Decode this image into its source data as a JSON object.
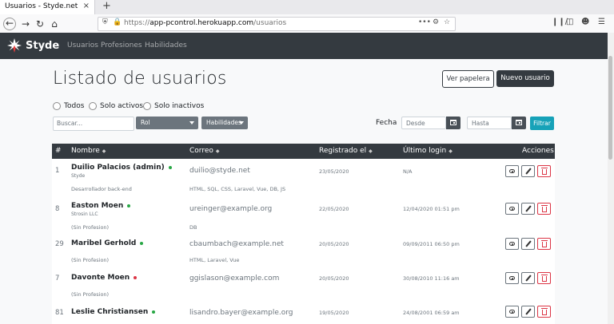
{
  "browser": {
    "tab_title": "Usuarios - Styde.net",
    "tab_close": "×",
    "new_tab": "+",
    "url_prefix": "https://",
    "url_host": "app-pcontrol.herokuapp.com",
    "url_path": "/usuarios",
    "url_more": "•••"
  },
  "app": {
    "brand": "Styde",
    "nav": [
      "Usuarios",
      "Profesiones",
      "Habilidades"
    ]
  },
  "page": {
    "title": "Listado de usuarios",
    "btn_trash": "Ver papelera",
    "btn_new": "Nuevo usuario"
  },
  "filters": {
    "radios": [
      "Todos",
      "Solo activos",
      "Solo inactivos"
    ],
    "search_placeholder": "Buscar...",
    "role_label": "Rol",
    "skills_label": "Habilidades",
    "date_label": "Fecha",
    "from_placeholder": "Desde",
    "to_placeholder": "Hasta",
    "filter_button": "Filtrar"
  },
  "table": {
    "headers": {
      "id": "#",
      "name": "Nombre",
      "email": "Correo",
      "registered": "Registrado el",
      "last_login": "Último login",
      "actions": "Acciones"
    },
    "sort_glyph": "◆",
    "rows": [
      {
        "id": "1",
        "name": "Duilio Palacios (admin)",
        "company": "Styde",
        "email": "duilio@styde.net",
        "registered": "23/05/2020",
        "last_login": "N/A",
        "profession": "Desarrollador back-end",
        "skills": "HTML, SQL, CSS, Laravel, Vue, DB, JS",
        "active": true
      },
      {
        "id": "8",
        "name": "Easton Moen",
        "company": "Strosin LLC",
        "email": "ureinger@example.org",
        "registered": "22/05/2020",
        "last_login": "12/04/2020 01:51 pm",
        "profession": "(Sin Profesion)",
        "skills": "DB",
        "active": true
      },
      {
        "id": "29",
        "name": "Maribel Gerhold",
        "company": "",
        "email": "cbaumbach@example.net",
        "registered": "20/05/2020",
        "last_login": "09/09/2011 06:50 pm",
        "profession": "(Sin Profesion)",
        "skills": "HTML, Laravel, Vue",
        "active": true
      },
      {
        "id": "7",
        "name": "Davonte Moen",
        "company": "",
        "email": "ggislason@example.com",
        "registered": "20/05/2020",
        "last_login": "30/08/2010 11:16 am",
        "profession": "(Sin Profesion)",
        "skills": "",
        "active": false
      },
      {
        "id": "81",
        "name": "Leslie Christiansen",
        "company": "",
        "email": "lisandro.bayer@example.org",
        "registered": "19/05/2020",
        "last_login": "24/08/2001 06:59 am",
        "profession": "",
        "skills": "",
        "active": true
      }
    ]
  }
}
